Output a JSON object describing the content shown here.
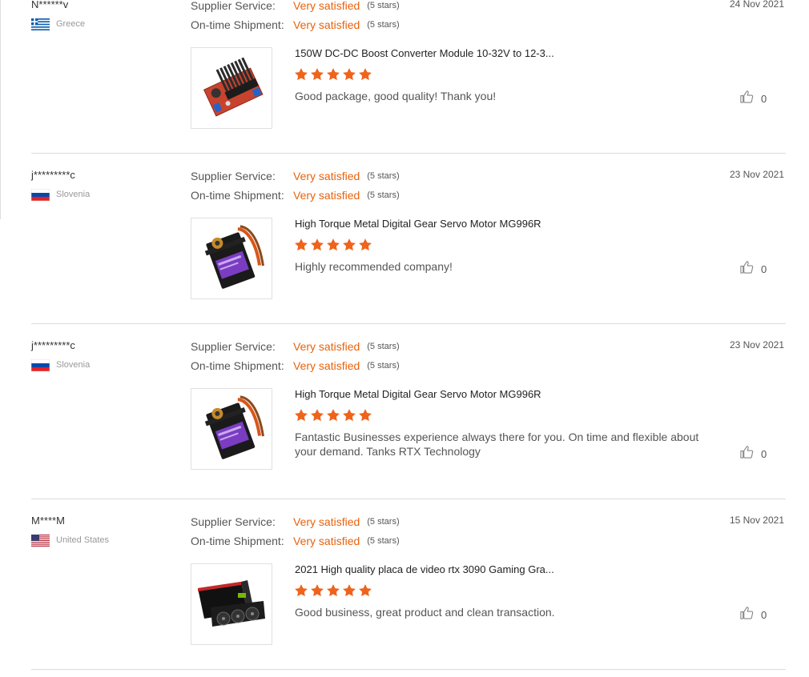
{
  "labels": {
    "supplier_service": "Supplier Service:",
    "on_time_shipment": "On-time Shipment:"
  },
  "colors": {
    "accent": "#e8620c",
    "star": "#f0631b",
    "divider": "#dcdcdc"
  },
  "reviews": [
    {
      "buyer": "N******v",
      "country": "Greece",
      "flag_icon": "greece-flag-icon",
      "date": "24 Nov 2021",
      "supplier_service": "Very satisfied",
      "supplier_service_stars": "(5 stars)",
      "shipment": "Very satisfied",
      "shipment_stars": "(5 stars)",
      "product_title": "150W DC-DC Boost Converter Module 10-32V to 12-3...",
      "product_image_icon": "boost-converter-module-image",
      "rating": 5,
      "text": "Good package, good quality! Thank you!",
      "likes": "0"
    },
    {
      "buyer": "j*********c",
      "country": "Slovenia",
      "flag_icon": "slovenia-flag-icon",
      "date": "23 Nov 2021",
      "supplier_service": "Very satisfied",
      "supplier_service_stars": "(5 stars)",
      "shipment": "Very satisfied",
      "shipment_stars": "(5 stars)",
      "product_title": "High Torque Metal Digital Gear Servo Motor MG996R",
      "product_image_icon": "servo-motor-image",
      "rating": 5,
      "text": "Highly recommended company!",
      "likes": "0"
    },
    {
      "buyer": "j*********c",
      "country": "Slovenia",
      "flag_icon": "slovenia-flag-icon",
      "date": "23 Nov 2021",
      "supplier_service": "Very satisfied",
      "supplier_service_stars": "(5 stars)",
      "shipment": "Very satisfied",
      "shipment_stars": "(5 stars)",
      "product_title": "High Torque Metal Digital Gear Servo Motor MG996R",
      "product_image_icon": "servo-motor-image",
      "rating": 5,
      "text": "Fantastic Businesses experience always there for you. On time and flexible about your demand. Tanks RTX Technology",
      "likes": "0"
    },
    {
      "buyer": "M****M",
      "country": "United States",
      "flag_icon": "usa-flag-icon",
      "date": "15 Nov 2021",
      "supplier_service": "Very satisfied",
      "supplier_service_stars": "(5 stars)",
      "shipment": "Very satisfied",
      "shipment_stars": "(5 stars)",
      "product_title": "2021 High quality placa de video rtx 3090 Gaming Gra...",
      "product_image_icon": "graphics-card-box-image",
      "rating": 5,
      "text": "Good business, great product and clean transaction.",
      "likes": "0"
    }
  ]
}
